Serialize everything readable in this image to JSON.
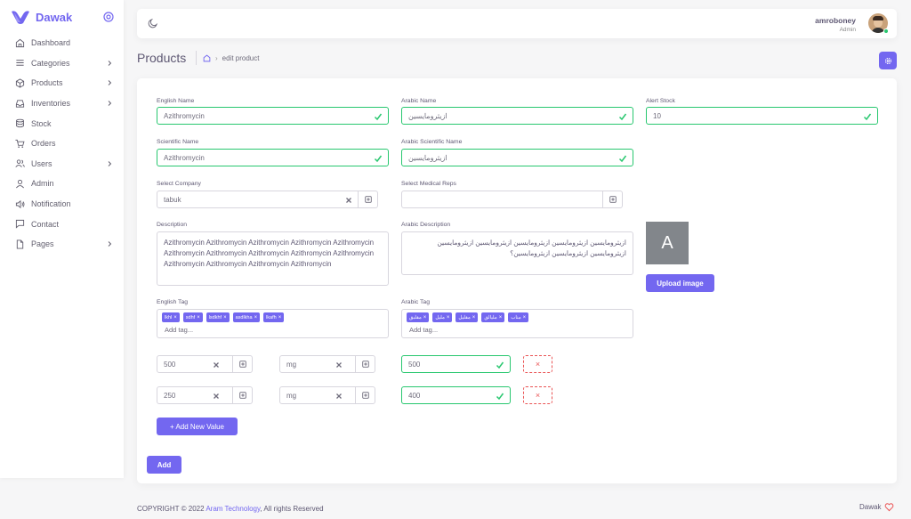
{
  "brand": {
    "name": "Dawak"
  },
  "sidebar": {
    "items": [
      {
        "label": "Dashboard",
        "icon": "home-icon"
      },
      {
        "label": "Categories",
        "icon": "list-icon",
        "has_children": true
      },
      {
        "label": "Products",
        "icon": "box-icon",
        "has_children": true
      },
      {
        "label": "Inventories",
        "icon": "inbox-icon",
        "has_children": true
      },
      {
        "label": "Stock",
        "icon": "database-icon"
      },
      {
        "label": "Orders",
        "icon": "cart-icon"
      },
      {
        "label": "Users",
        "icon": "users-icon",
        "has_children": true
      },
      {
        "label": "Admin",
        "icon": "user-icon"
      },
      {
        "label": "Notification",
        "icon": "speaker-icon"
      },
      {
        "label": "Contact",
        "icon": "message-icon"
      },
      {
        "label": "Pages",
        "icon": "file-icon",
        "has_children": true
      }
    ]
  },
  "navbar": {
    "username": "amroboney",
    "role": "Admin"
  },
  "header": {
    "title": "Products",
    "breadcrumb_current": "edit product"
  },
  "form": {
    "english_name": {
      "label": "English Name",
      "value": "Azithromycin"
    },
    "arabic_name": {
      "label": "Arabic Name",
      "value": "ازيثرومايسين"
    },
    "alert_stock": {
      "label": "Alert Stock",
      "value": "10"
    },
    "scientific_name": {
      "label": "Scientific Name",
      "value": "Azithromycin"
    },
    "arabic_scientific_name": {
      "label": "Arabic Scientific Name",
      "value": "ازيثرومايسين"
    },
    "company": {
      "label": "Select Company",
      "value": "tabuk"
    },
    "medical_reps": {
      "label": "Select Medical Reps",
      "value": ""
    },
    "description": {
      "label": "Description",
      "value": "Azithromycin Azithromycin Azithromycin Azithromycin Azithromycin Azithromycin Azithromycin Azithromycin Azithromycin Azithromycin Azithromycin Azithromycin Azithromycin Azithromycin"
    },
    "arabic_description": {
      "label": "Arabic Description",
      "value": "ازيثرومايسين ازيثرومايسين ازيثرومايسين ازيثرومايسين ازيثرومايسين ازيثرومايسين ازيثرومايسين ازيثرومايسين؟"
    },
    "image": {
      "placeholder_letter": "A",
      "upload_label": "Upload image"
    },
    "english_tag": {
      "label": "English Tag",
      "tags": [
        "lkhl",
        "sdhf",
        "lsdkhf",
        "asdlkha",
        "lkafh"
      ],
      "placeholder": "Add tag..."
    },
    "arabic_tag": {
      "label": "Arabic Tag",
      "tags": [
        "مقلبق",
        "مليل",
        "مقليل",
        "مليالق",
        "مناب"
      ],
      "placeholder": "Add tag..."
    },
    "values": [
      {
        "quantity": "500",
        "unit": "mg",
        "price": "500"
      },
      {
        "quantity": "250",
        "unit": "mg",
        "price": "400"
      }
    ],
    "add_value_label": "+ Add New Value",
    "submit_label": "Add"
  },
  "footer": {
    "copyright": "COPYRIGHT © 2022 ",
    "company": "Aram Technology",
    "rights": ", All rights Reserved",
    "brand": "Dawak"
  },
  "colors": {
    "primary": "#7367f0",
    "success": "#28c76f",
    "danger": "#ea5455"
  }
}
